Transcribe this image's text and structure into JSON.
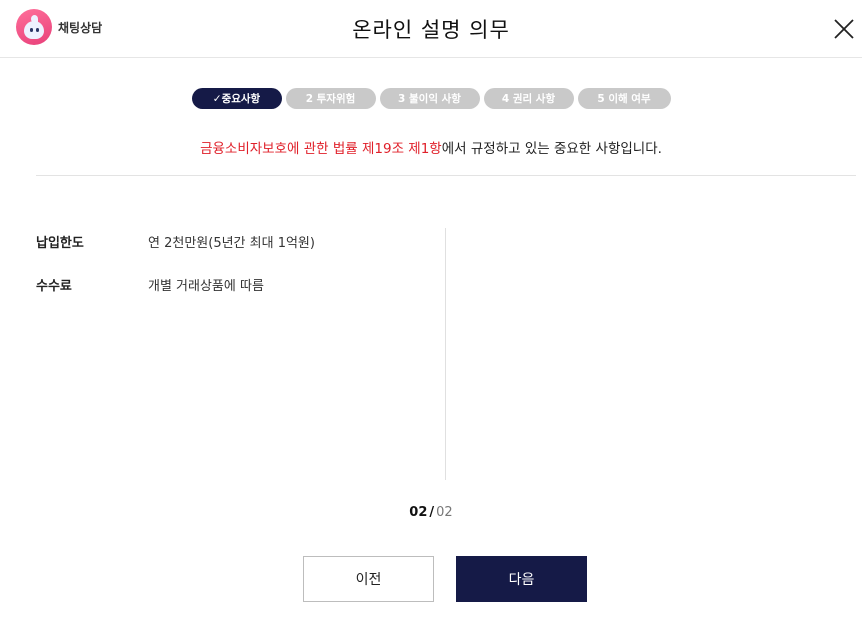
{
  "header": {
    "chat_label": "채팅상담",
    "title": "온라인 설명 의무"
  },
  "steps": [
    {
      "label": "✓중요사항",
      "active": true
    },
    {
      "label": "2 투자위험",
      "active": false
    },
    {
      "label": "3 불이익 사항",
      "active": false
    },
    {
      "label": "4 권리 사항",
      "active": false
    },
    {
      "label": "5 이해 여부",
      "active": false
    }
  ],
  "notice": {
    "highlight": "금융소비자보호에 관한 법률 제19조 제1항",
    "rest": "에서 규정하고 있는 중요한 사항입니다."
  },
  "info_rows": [
    {
      "key": "납입한도",
      "value": "연 2천만원(5년간 최대 1억원)"
    },
    {
      "key": "수수료",
      "value": "개별 거래상품에 따름"
    }
  ],
  "pager": {
    "current": "02",
    "separator": "/",
    "total": "02"
  },
  "buttons": {
    "prev": "이전",
    "next": "다음"
  },
  "colors": {
    "accent": "#151a47",
    "highlight": "#e0202a",
    "inactive_step": "#c9c9c9"
  }
}
